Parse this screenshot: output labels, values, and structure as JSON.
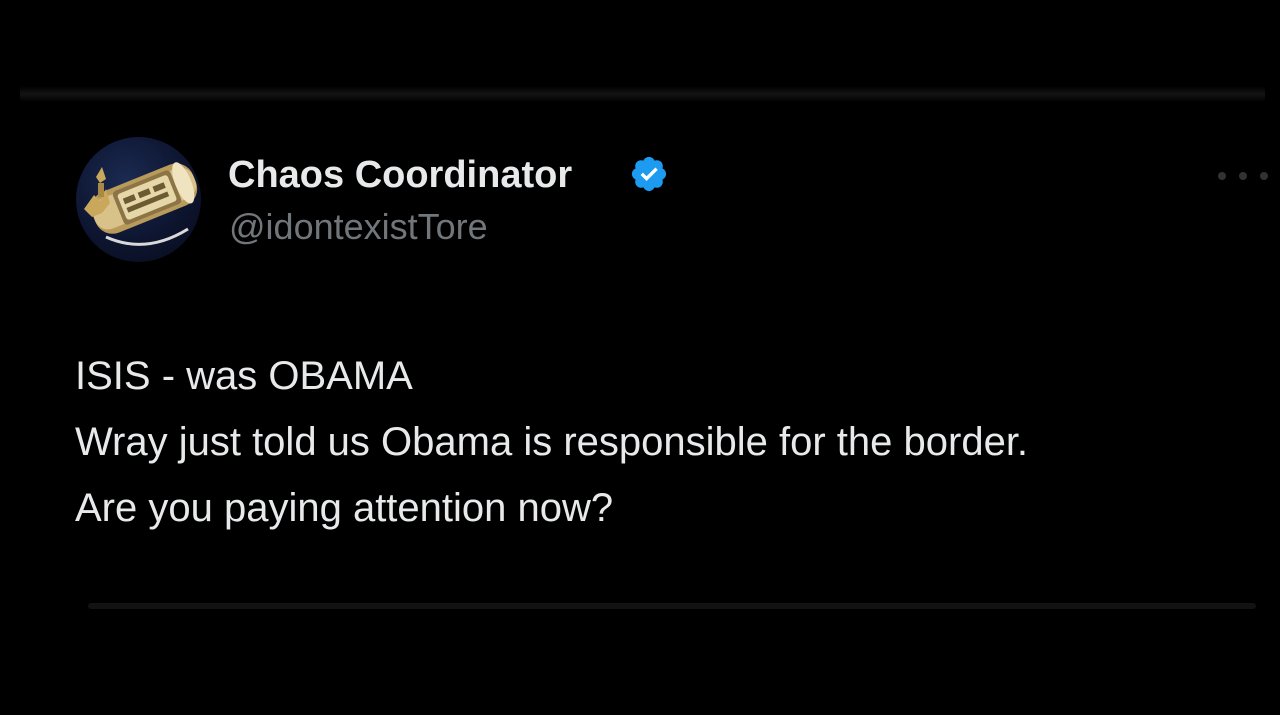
{
  "tweet": {
    "author": {
      "display_name": "Chaos Coordinator",
      "handle": "@idontexistTore",
      "verified": true,
      "avatar_icon": "gold-ring-icon"
    },
    "more_icon": "ellipsis-icon",
    "lines": [
      "ISIS - was OBAMA",
      "Wray just told us Obama is responsible for the border.",
      "Are you paying attention now?"
    ]
  },
  "colors": {
    "background": "#000000",
    "primary_text": "#e7e9ea",
    "secondary_text": "#71767b",
    "verified_blue": "#1d9bf0"
  }
}
